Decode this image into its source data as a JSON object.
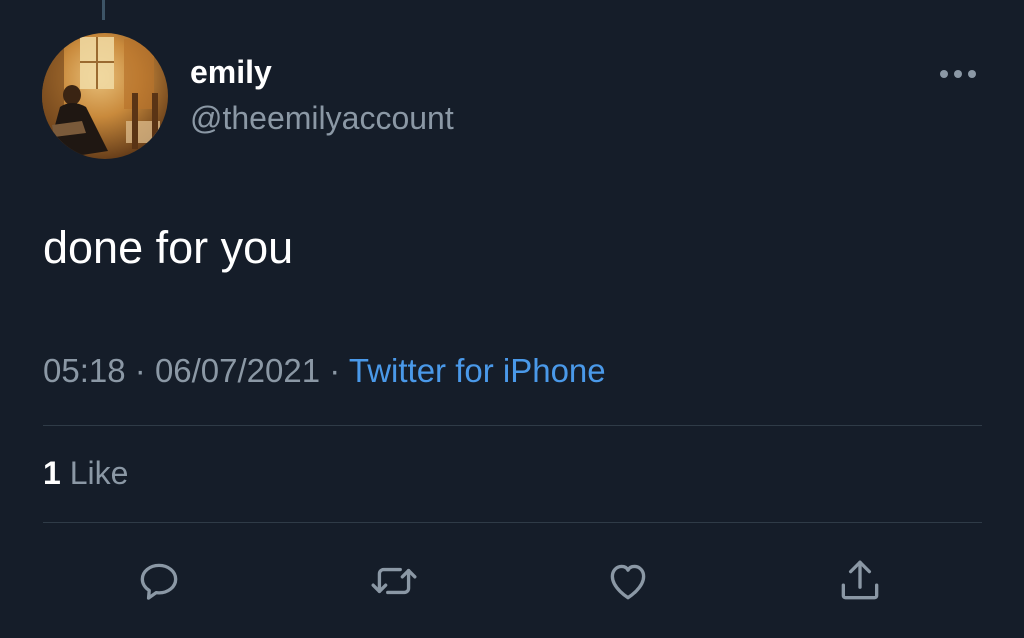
{
  "tweet": {
    "display_name": "emily",
    "handle": "@theemilyaccount",
    "text": "done for you",
    "time": "05:18",
    "date": "06/07/2021",
    "separator": "·",
    "source": "Twitter for iPhone"
  },
  "stats": {
    "like_count": "1",
    "like_label": "Like"
  },
  "colors": {
    "background": "#151d29",
    "text": "#ffffff",
    "secondary": "#8b98a5",
    "link": "#4a99e9",
    "divider": "#2f3b47"
  },
  "icons": {
    "more": "more-icon",
    "reply": "reply-icon",
    "retweet": "retweet-icon",
    "like": "heart-icon",
    "share": "share-icon"
  }
}
